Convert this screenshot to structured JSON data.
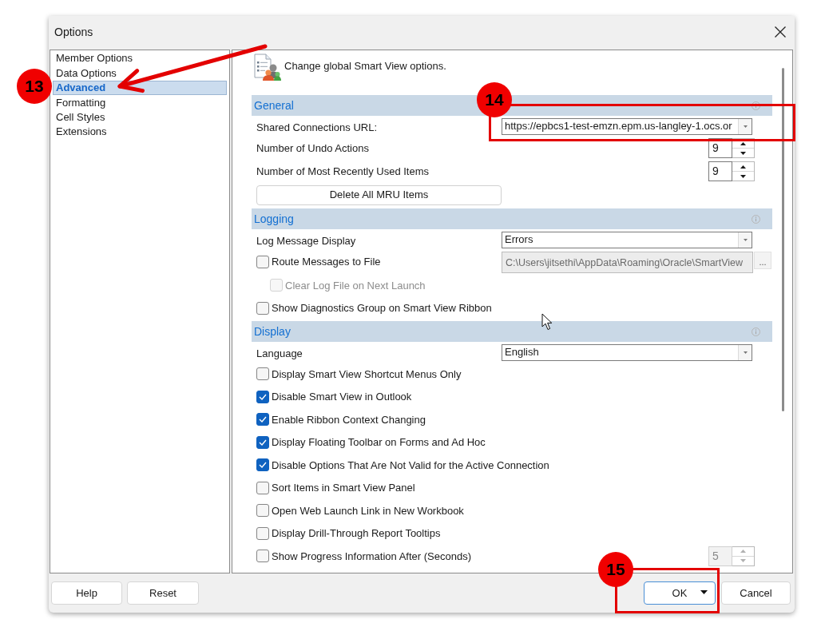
{
  "window": {
    "title": "Options"
  },
  "sidebar": {
    "items": [
      {
        "label": "Member Options",
        "selected": false
      },
      {
        "label": "Data Options",
        "selected": false
      },
      {
        "label": "Advanced",
        "selected": true
      },
      {
        "label": "Formatting",
        "selected": false
      },
      {
        "label": "Cell Styles",
        "selected": false
      },
      {
        "label": "Extensions",
        "selected": false
      }
    ]
  },
  "panel": {
    "description": "Change global Smart View options.",
    "sections": [
      {
        "title": "General",
        "rows": [
          {
            "kind": "combo",
            "label": "Shared Connections URL:",
            "value": "https://epbcs1-test-emzn.epm.us-langley-1.ocs.or"
          },
          {
            "kind": "spinner",
            "label": "Number of Undo Actions",
            "value": "9",
            "disabled": false
          },
          {
            "kind": "spinner",
            "label": "Number of Most Recently Used Items",
            "value": "9",
            "disabled": false
          },
          {
            "kind": "button",
            "label": "Delete All MRU Items"
          }
        ]
      },
      {
        "title": "Logging",
        "rows": [
          {
            "kind": "combo",
            "label": "Log Message Display",
            "value": "Errors"
          },
          {
            "kind": "checkbox_path",
            "label": "Route Messages to File",
            "checked": false,
            "disabled": false,
            "path": "C:\\Users\\jitsethi\\AppData\\Roaming\\Oracle\\SmartView",
            "path_disabled": true,
            "browse_label": "...",
            "children": [
              {
                "kind": "checkbox",
                "label": "Clear Log File on Next Launch",
                "checked": false,
                "disabled": true
              }
            ]
          },
          {
            "kind": "checkbox",
            "label": "Show Diagnostics Group on Smart View Ribbon",
            "checked": false,
            "disabled": false
          }
        ]
      },
      {
        "title": "Display",
        "rows": [
          {
            "kind": "combo",
            "label": "Language",
            "value": "English"
          },
          {
            "kind": "checkbox",
            "label": "Display Smart View Shortcut Menus Only",
            "checked": false,
            "disabled": false
          },
          {
            "kind": "checkbox",
            "label": "Disable Smart View in Outlook",
            "checked": true,
            "disabled": false
          },
          {
            "kind": "checkbox",
            "label": "Enable Ribbon Context Changing",
            "checked": true,
            "disabled": false
          },
          {
            "kind": "checkbox",
            "label": "Display Floating Toolbar on Forms and Ad Hoc",
            "checked": true,
            "disabled": false
          },
          {
            "kind": "checkbox",
            "label": "Disable Options That Are Not Valid for the Active Connection",
            "checked": true,
            "disabled": false
          },
          {
            "kind": "checkbox",
            "label": "Sort Items in Smart View Panel",
            "checked": false,
            "disabled": false
          },
          {
            "kind": "checkbox",
            "label": "Open Web Launch Link in New Workbook",
            "checked": false,
            "disabled": false
          },
          {
            "kind": "checkbox",
            "label": "Display Drill-Through Report Tooltips",
            "checked": false,
            "disabled": false
          },
          {
            "kind": "checkbox_spinner",
            "label": "Show Progress Information After (Seconds)",
            "checked": false,
            "disabled": false,
            "value": "5",
            "spinner_disabled": true
          }
        ]
      }
    ]
  },
  "footer": {
    "left_buttons": [
      {
        "label": "Help",
        "default": false,
        "has_menu": false
      },
      {
        "label": "Reset",
        "default": false,
        "has_menu": false
      }
    ],
    "right_buttons": [
      {
        "label": "OK",
        "default": true,
        "has_menu": true
      },
      {
        "label": "Cancel",
        "default": false,
        "has_menu": false
      }
    ]
  },
  "annotations": [
    {
      "number": "13",
      "kind": "arrow"
    },
    {
      "number": "14",
      "kind": "frame"
    },
    {
      "number": "15",
      "kind": "frame"
    }
  ]
}
